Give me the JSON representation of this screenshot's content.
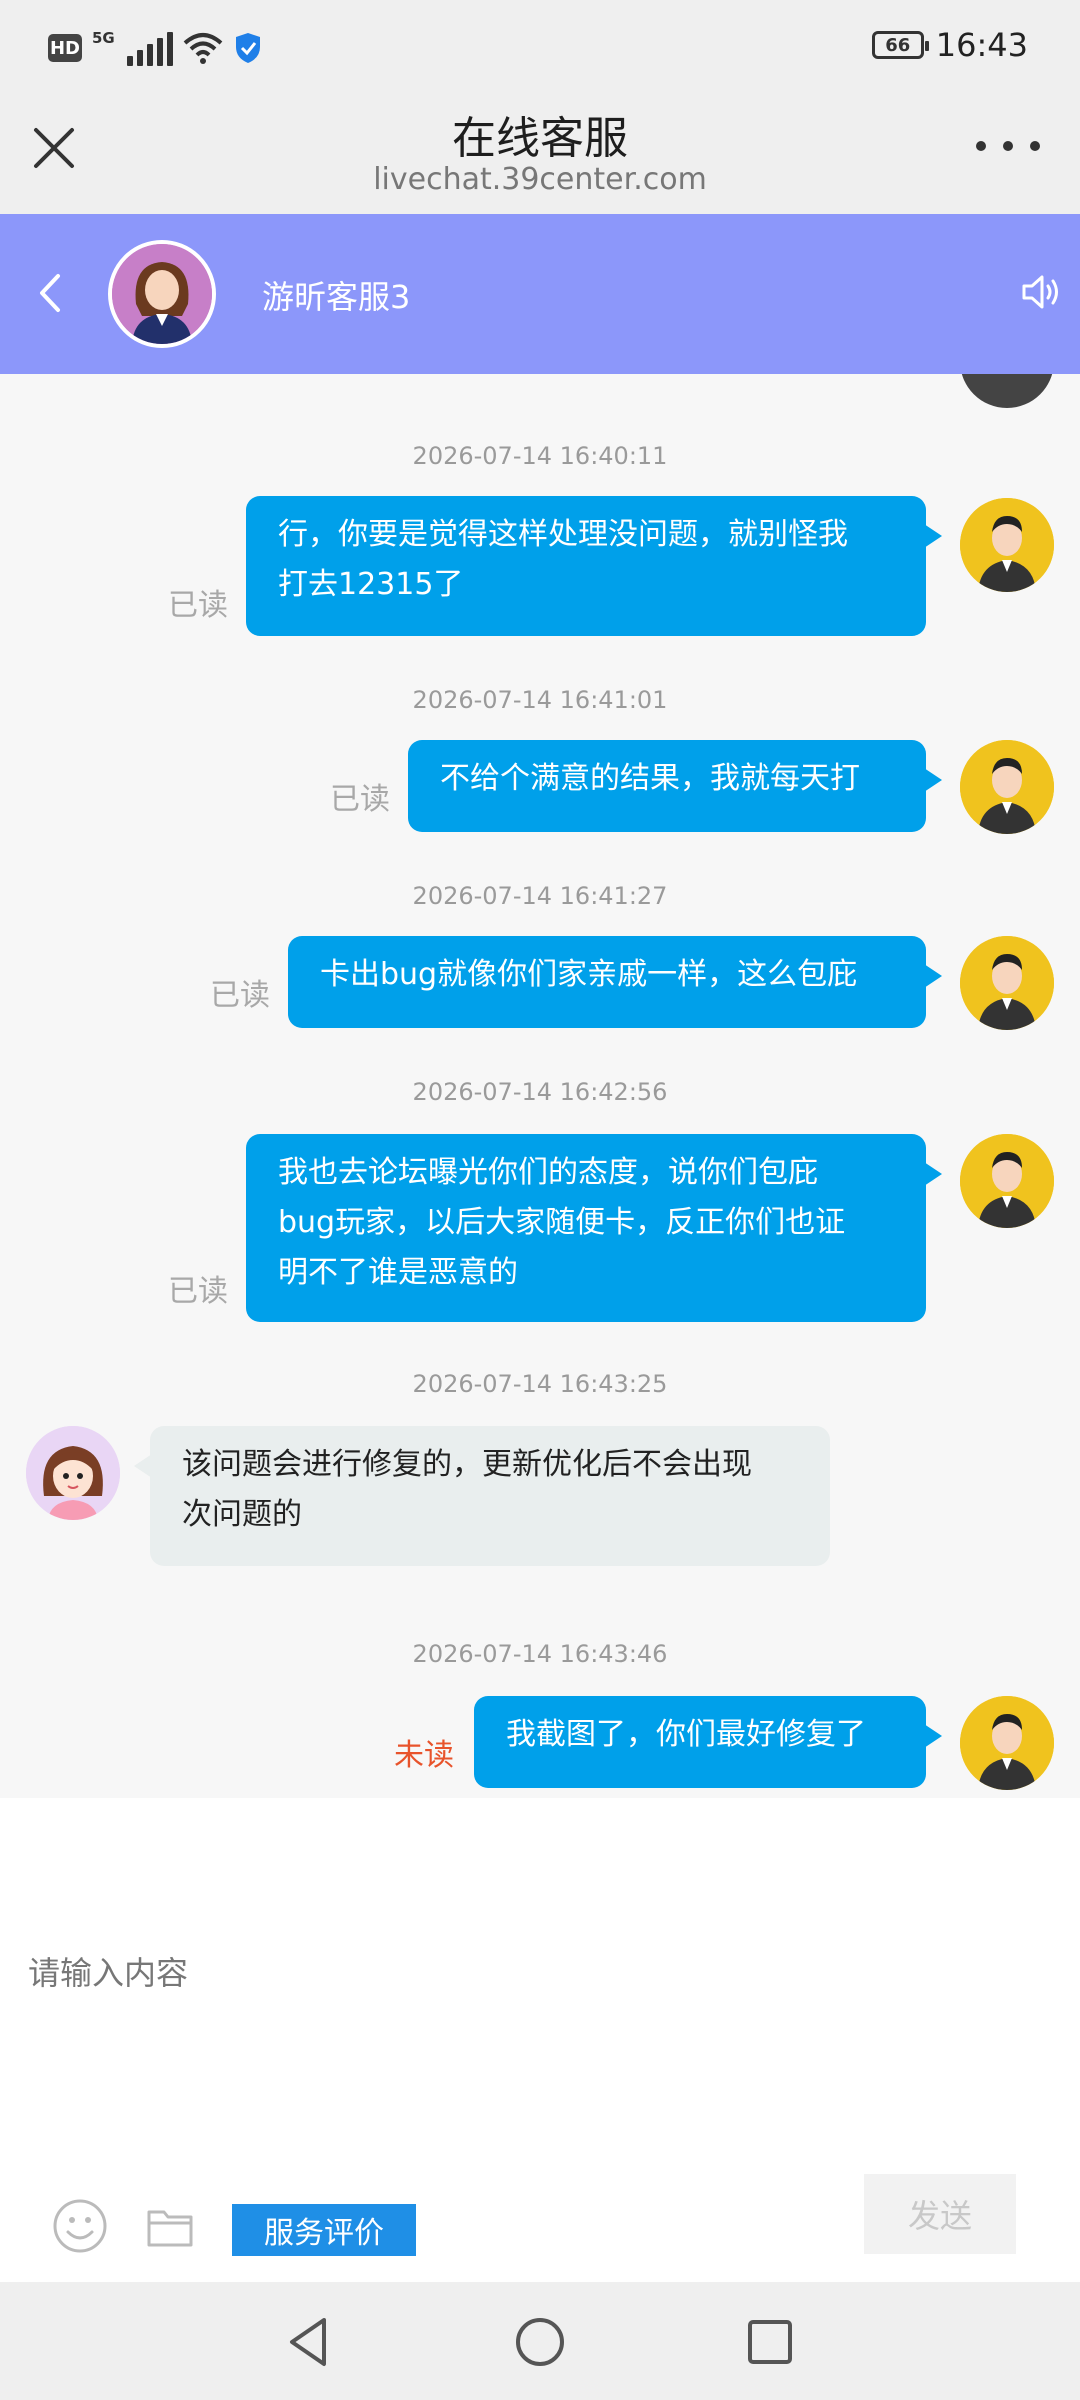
{
  "status_bar": {
    "hd": "HD",
    "network": "5G",
    "battery": "66",
    "time": "16:43"
  },
  "browser": {
    "title": "在线客服",
    "url": "livechat.39center.com"
  },
  "chat_header": {
    "agent_name": "游昕客服3"
  },
  "messages": [
    {
      "time": "2026-07-14 16:40:11",
      "from": "user",
      "lines": [
        "行，你要是觉得这样处理没问题，就别怪我",
        "打去12315了"
      ],
      "status": "已读"
    },
    {
      "time": "2026-07-14 16:41:01",
      "from": "user",
      "lines": [
        "不给个满意的结果，我就每天打"
      ],
      "status": "已读"
    },
    {
      "time": "2026-07-14 16:41:27",
      "from": "user",
      "lines": [
        "卡出bug就像你们家亲戚一样，这么包庇"
      ],
      "status": "已读"
    },
    {
      "time": "2026-07-14 16:42:56",
      "from": "user",
      "lines": [
        "我也去论坛曝光你们的态度，说你们包庇",
        "bug玩家，以后大家随便卡，反正你们也证",
        "明不了谁是恶意的"
      ],
      "status": "已读"
    },
    {
      "time": "2026-07-14 16:43:25",
      "from": "agent",
      "lines": [
        "该问题会进行修复的，更新优化后不会出现",
        "次问题的"
      ]
    },
    {
      "time": "2026-07-14 16:43:46",
      "from": "user",
      "lines": [
        "我截图了，你们最好修复了"
      ],
      "status": "未读"
    }
  ],
  "input": {
    "placeholder": "请输入内容",
    "rating_label": "服务评价",
    "send_label": "发送"
  },
  "colors": {
    "header": "#8c97fa",
    "bubble": "#00a0ea",
    "unread": "#e8532b",
    "rating": "#1f8fe6"
  }
}
